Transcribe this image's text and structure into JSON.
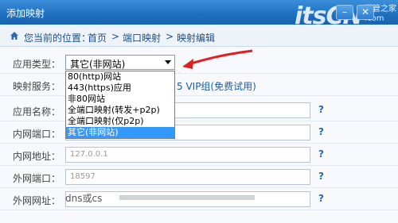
{
  "window": {
    "title": "添加映射",
    "minimize_glyph": "–",
    "close_glyph": "✕"
  },
  "watermark": {
    "text": "itsCN",
    "sub_line1": "网管之家",
    "sub_line2": ".com"
  },
  "breadcrumb": {
    "prefix": "您当前的位置：",
    "items": [
      "首页",
      "端口映射",
      "映射编辑"
    ],
    "separator": ">"
  },
  "form": {
    "app_type": {
      "label": "应用类型：",
      "value": "其它(非网站)"
    },
    "mapping_service": {
      "label": "映射服务：",
      "link_suffix": "5 VIP组(免费试用)"
    },
    "app_name": {
      "label": "应用名称：",
      "value": ""
    },
    "lan_port": {
      "label": "内网端口：",
      "value": ""
    },
    "lan_addr": {
      "label": "内网地址：",
      "value": "127.0.0.1"
    },
    "wan_port": {
      "label": "外网端口：",
      "value": "18597"
    },
    "wan_url": {
      "label": "外网网址：",
      "value": ""
    },
    "footer_fragment": "dns或cs"
  },
  "dropdown_options": [
    {
      "label": "80(http)网站",
      "selected": false
    },
    {
      "label": "443(https)应用",
      "selected": false
    },
    {
      "label": "非80网站",
      "selected": false
    },
    {
      "label": "全端口映射(转发+p2p)",
      "selected": false
    },
    {
      "label": "全端口映射(仅p2p)",
      "selected": false
    },
    {
      "label": "其它(非网站)",
      "selected": true
    }
  ],
  "help_glyph": "?",
  "colors": {
    "title_bar": "#1f6fc0",
    "link": "#1a5ea8",
    "selection": "#3399ff",
    "annotation_arrow": "#e02020"
  }
}
